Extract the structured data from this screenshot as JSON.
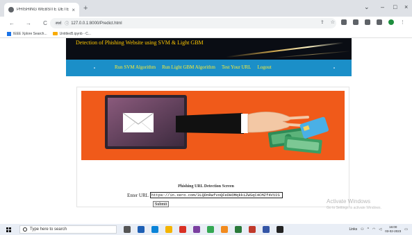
{
  "browser": {
    "tab_title": "PHISHING WEBSITE DETECTION",
    "tab_close": "×",
    "new_tab": "+",
    "url": "127.0.0.1:8000/Predict.html",
    "site_badge": "स्पर्श",
    "window_controls": [
      "⌄",
      "–",
      "□",
      "×"
    ],
    "nav_icons": [
      "←",
      "→",
      "C"
    ],
    "bookmarks": [
      "IEEE Xplore Search...",
      "Untitled5.ipynb - C..."
    ]
  },
  "site": {
    "title": "Detection of Phishing Website using SVM & Light GBM",
    "menu": [
      "Run SVM Algorithm",
      "Run Light GBM Algorithm",
      "Test Your URL",
      "Logout"
    ],
    "hero_alt": "Phishing illustration",
    "section_title": "Phishing URL Detection Screen",
    "url_label": "Enter URL",
    "url_value": "https://in.xero.com/3LQDnRwfvoQFeDHOMqkkiZWSqC4CMZf4VV2S",
    "submit_label": "Submit"
  },
  "watermark": {
    "title": "Activate Windows",
    "subtitle": "Go to Settings to activate Windows."
  },
  "taskbar": {
    "search_placeholder": "Type here to search",
    "tray_links": "Links",
    "time": "16:00",
    "date": "03-02-2023"
  },
  "colors": {
    "header_bg": "#0a0d14",
    "title_gold": "#ffc800",
    "menu_bg": "#1b8fc8",
    "menu_text": "#ffee33",
    "hero_bg": "#f05a1a"
  }
}
